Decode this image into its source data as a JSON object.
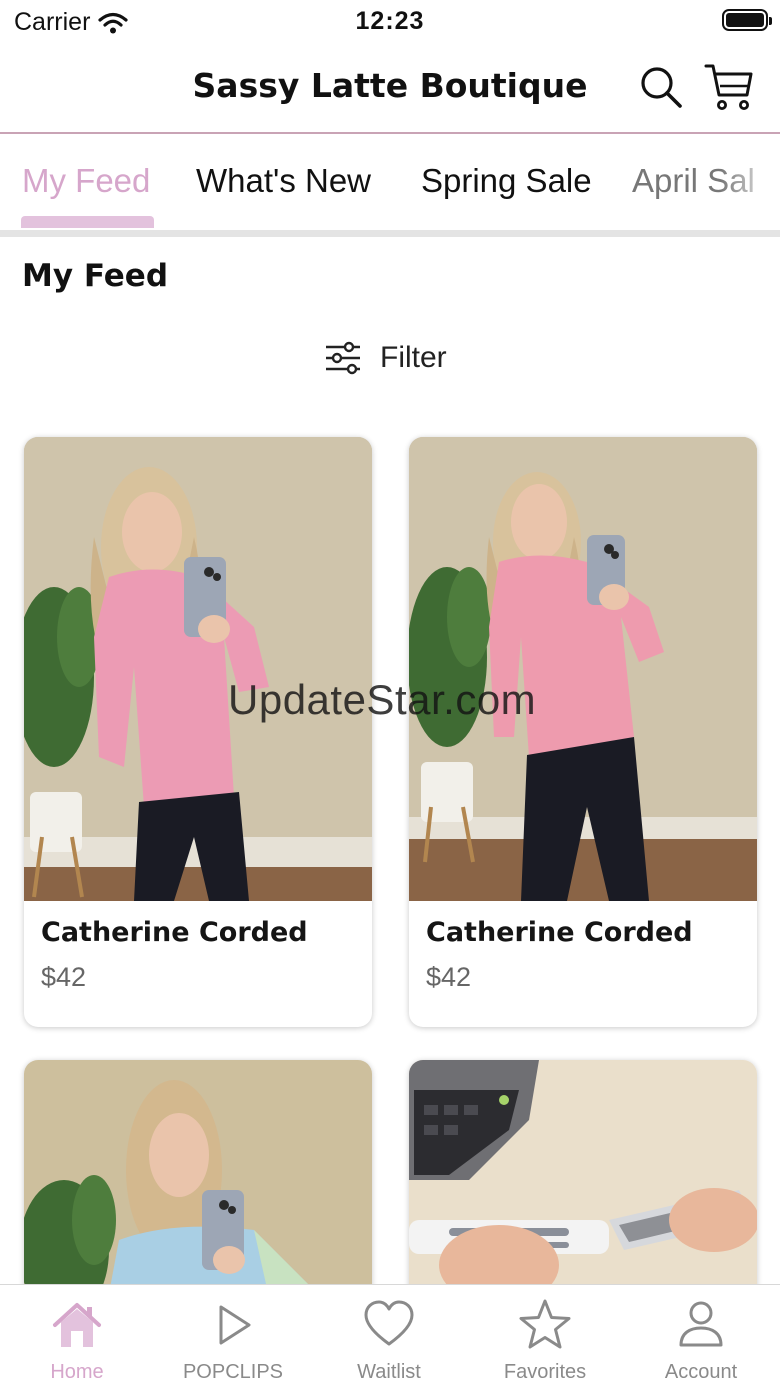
{
  "status_bar": {
    "carrier": "Carrier",
    "time": "12:23"
  },
  "header": {
    "title": "Sassy Latte Boutique",
    "search_icon": "search-icon",
    "cart_icon": "cart-icon"
  },
  "tabs": [
    {
      "label": "My Feed",
      "active": true
    },
    {
      "label": "What's New",
      "active": false
    },
    {
      "label": "Spring Sale",
      "active": false
    },
    {
      "label": "April Sal",
      "active": false
    }
  ],
  "section": {
    "title": "My Feed"
  },
  "filter": {
    "label": "Filter",
    "icon": "sliders-icon"
  },
  "products": [
    {
      "name": "Catherine Corded",
      "price": "$42",
      "image": "model-pink-sweatshirt"
    },
    {
      "name": "Catherine Corded",
      "price": "$42",
      "image": "model-pink-sweatshirt"
    },
    {
      "name": "",
      "price": "",
      "image": "model-blue-sweatshirt"
    },
    {
      "name": "",
      "price": "",
      "image": "screen-cleaning-pen-laptop"
    }
  ],
  "watermark": "UpdateStar.com",
  "bottom_nav": [
    {
      "label": "Home",
      "icon": "home-icon",
      "active": true
    },
    {
      "label": "POPCLIPS",
      "icon": "play-icon",
      "active": false
    },
    {
      "label": "Waitlist",
      "icon": "heart-icon",
      "active": false
    },
    {
      "label": "Favorites",
      "icon": "star-icon",
      "active": false
    },
    {
      "label": "Account",
      "icon": "user-icon",
      "active": false
    }
  ],
  "colors": {
    "accent": "#d6a6cb",
    "accent_light": "#e3c2dd",
    "header_border": "#c9a3b5",
    "inactive_text": "#8a8a8a"
  }
}
